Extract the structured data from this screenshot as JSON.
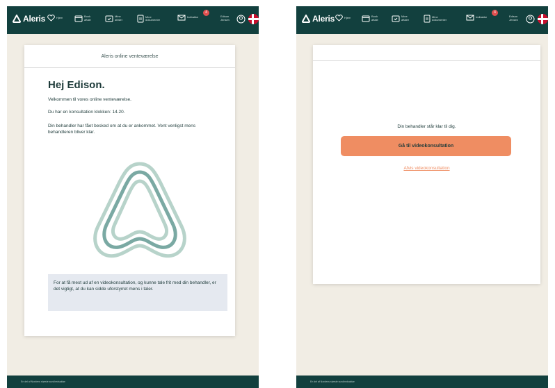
{
  "colors": {
    "brand_dark": "#12403e",
    "accent": "#ef8d62",
    "background": "#f1ede4",
    "tip_box": "#e5e9f0",
    "badge": "#e05050"
  },
  "nav": {
    "logo_text": "Aleris",
    "home": {
      "label": "Hjem",
      "icon": "heart-icon"
    },
    "book": {
      "label": "Book\naftale",
      "icon": "calendar-icon"
    },
    "appointments": {
      "label": "Mine\naftaler",
      "icon": "calendar-check-icon"
    },
    "documents": {
      "label": "Mine\ndokumenter",
      "icon": "document-icon"
    },
    "inbox": {
      "label": "Indbakke",
      "icon": "mail-icon",
      "badge": "4"
    },
    "user": {
      "name": "Edison\nJensen",
      "icon": "user-circle-icon"
    },
    "language": {
      "flag": "danish-flag-icon"
    }
  },
  "footer": {
    "text": "En del af Nordens største sundhedsaktør"
  },
  "waiting": {
    "header": "Aleris online venteværelse",
    "greeting": "Hej Edison.",
    "welcome": "Velkommen til vores online venteværelse.",
    "appointment": "Du har en konsultation klokken: 14.20.",
    "notified": "Din behandler har fået besked om at du er ankommet. Vent venligst mens behandleren bliver klar.",
    "tip": "For at få mest ud af en videokonsultation, og kunne tale frit med din behandler, er det vigtigt, at du kan sidde uforstyrret mens i taler."
  },
  "ready": {
    "text": "Din behandler står klar til dig.",
    "button": "Gå til videokonsultation",
    "decline": "Afvis videokonsultation"
  }
}
